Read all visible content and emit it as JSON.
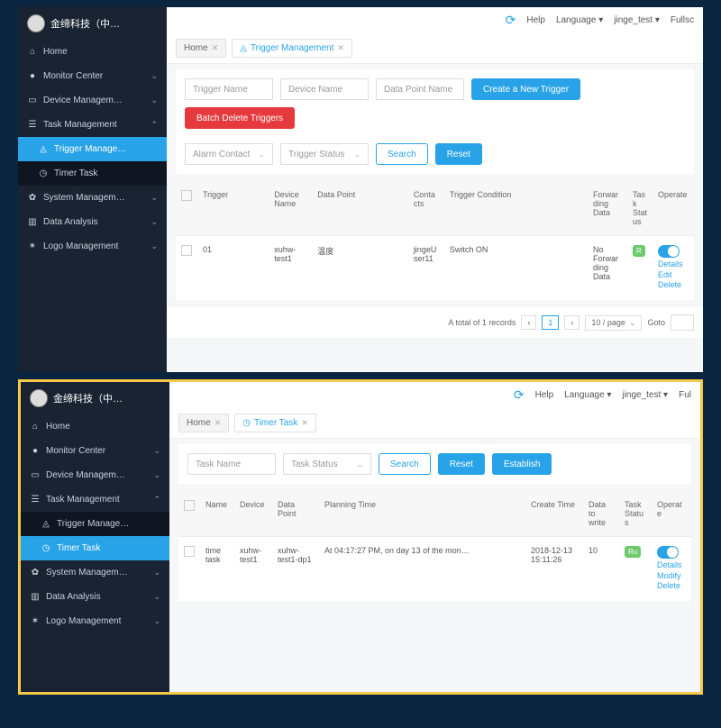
{
  "brand": "金缔科技（中…",
  "topbar": {
    "help": "Help",
    "language": "Language",
    "user": "jinge_test",
    "full": "Fullsc"
  },
  "nav": {
    "home": "Home",
    "monitor": "Monitor Center",
    "device": "Device Managem…",
    "task": "Task Management",
    "trigger": "Trigger Manage…",
    "timer": "Timer Task",
    "system": "System Managem…",
    "data": "Data Analysis",
    "logo": "Logo Management"
  },
  "panel1": {
    "tabs": {
      "home": "Home",
      "trigger": "Trigger Management"
    },
    "filters": {
      "triggerName": "Trigger Name",
      "deviceName": "Device Name",
      "dataPointName": "Data Point Name",
      "alarmContact": "Alarm Contact",
      "triggerStatus": "Trigger Status",
      "search": "Search",
      "reset": "Reset",
      "create": "Create a New Trigger",
      "batchDelete": "Batch Delete Triggers"
    },
    "headers": {
      "trigger": "Trigger",
      "device": "Device Name",
      "dataPoint": "Data Point",
      "contacts": "Contacts",
      "condition": "Trigger Condition",
      "forwarding": "Forwarding Data",
      "status": "Task Status",
      "operate": "Operate"
    },
    "row": {
      "trigger": "01",
      "device": "xuhw-test1",
      "dataPoint": "温度",
      "contacts": "jingeUser11",
      "condition": "Switch ON",
      "forwarding": "No Forwarding Data",
      "status": "R",
      "op_details": "Details",
      "op_edit": "Edit",
      "op_delete": "Delete"
    },
    "pager": {
      "total": "A total of 1 records",
      "page": "1",
      "perPage": "10 / page",
      "goto": "Goto"
    }
  },
  "panel2": {
    "topbar_full": "Ful",
    "tabs": {
      "home": "Home",
      "timer": "Timer Task"
    },
    "filters": {
      "taskName": "Task Name",
      "taskStatus": "Task Status",
      "search": "Search",
      "reset": "Reset",
      "establish": "Establish"
    },
    "headers": {
      "name": "Name",
      "device": "Device",
      "dataPoint": "Data Point",
      "planning": "Planning Time",
      "create": "Create Time",
      "dataWrite": "Data to write",
      "status": "Task Status",
      "operate": "Operate"
    },
    "row": {
      "name": "time task",
      "device": "xuhw-test1",
      "dataPoint": "xuhw-test1-dp1",
      "planning": "At 04:17:27 PM, on day 13 of the mon…",
      "create": "2018-12-13 15:11:26",
      "dataWrite": "10",
      "status": "Ru",
      "op_details": "Details",
      "op_modify": "Modify",
      "op_delete": "Delete"
    }
  }
}
